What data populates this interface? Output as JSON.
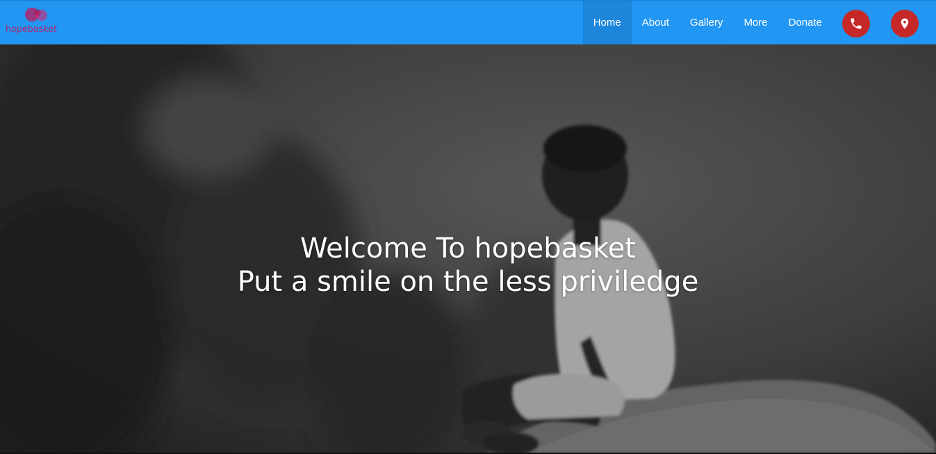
{
  "brand": {
    "name": "hopebasket",
    "logo_color": "#c2185b"
  },
  "nav": {
    "items": [
      {
        "label": "Home",
        "active": true
      },
      {
        "label": "About",
        "active": false
      },
      {
        "label": "Gallery",
        "active": false
      },
      {
        "label": "More",
        "active": false
      },
      {
        "label": "Donate",
        "active": false
      }
    ],
    "phone_icon": "phone-icon",
    "location_icon": "location-pin-icon",
    "bar_color": "#2196f3",
    "button_color": "#c62828"
  },
  "hero": {
    "line1": "Welcome To hopebasket",
    "line2": "Put a smile on the less priviledge"
  }
}
